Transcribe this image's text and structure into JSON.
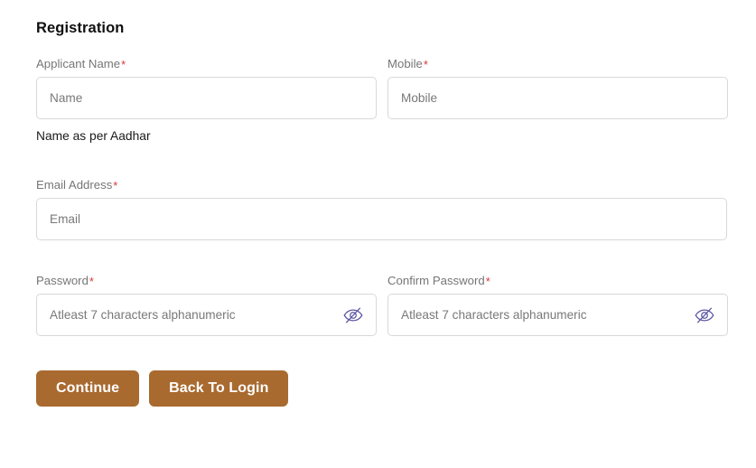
{
  "page": {
    "title": "Registration",
    "accent_color": "#a96a30",
    "required_marker": "*",
    "required_color": "#d6393b",
    "eye_icon_color": "#5b57a3"
  },
  "fields": {
    "applicant_name": {
      "label": "Applicant Name",
      "placeholder": "Name",
      "value": "",
      "required": true
    },
    "mobile": {
      "label": "Mobile",
      "placeholder": "Mobile",
      "value": "",
      "required": true
    },
    "name_note": "Name as per Aadhar",
    "email": {
      "label": "Email Address",
      "placeholder": "Email",
      "value": "",
      "required": true
    },
    "password": {
      "label": "Password",
      "placeholder": "Atleast 7 characters alphanumeric",
      "value": "",
      "required": true,
      "toggle_icon": "eye-slash-icon"
    },
    "confirm_password": {
      "label": "Confirm Password",
      "placeholder": "Atleast 7 characters alphanumeric",
      "value": "",
      "required": true,
      "toggle_icon": "eye-slash-icon"
    }
  },
  "actions": {
    "continue_label": "Continue",
    "back_to_login_label": "Back To Login"
  }
}
